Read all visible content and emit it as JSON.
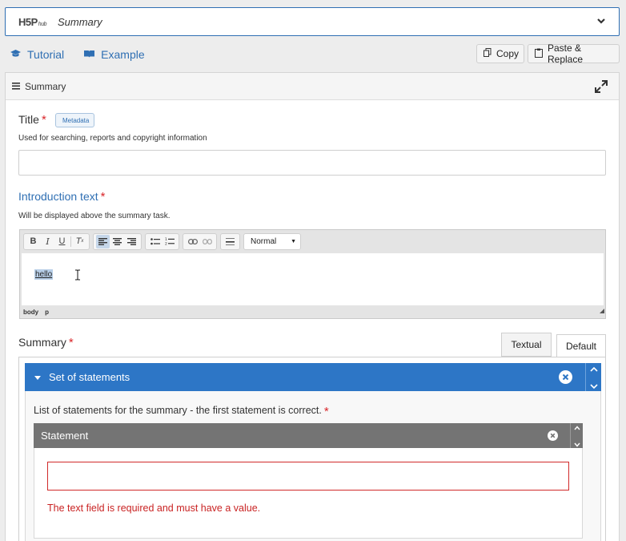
{
  "selector": {
    "logo": "H5P",
    "logo_sub": "hub",
    "title": "Summary"
  },
  "links": {
    "tutorial": "Tutorial",
    "example": "Example"
  },
  "buttons": {
    "copy": "Copy",
    "paste_replace": "Paste & Replace"
  },
  "panel": {
    "title": "Summary",
    "title_field": {
      "label": "Title",
      "required_mark": "*",
      "metadata_label": "Metadata",
      "description": "Used for searching, reports and copyright information",
      "value": ""
    },
    "intro_field": {
      "label": "Introduction text",
      "required_mark": "*",
      "description": "Will be displayed above the summary task.",
      "content": "hello",
      "path": [
        "body",
        "p"
      ],
      "format": "Normal"
    },
    "summary_field": {
      "label": "Summary",
      "required_mark": "*",
      "tabs": [
        "Textual",
        "Default"
      ],
      "active_tab": "Default",
      "group_title": "Set of statements",
      "list_description": "List of statements for the summary - the first statement is correct.",
      "required_mark_list": "*",
      "statement_title": "Statement",
      "statement_value": "",
      "error": "The text field is required and must have a value."
    }
  },
  "colors": {
    "accent": "#2d76c6",
    "error": "#d12a2a",
    "statement_bar": "#747474"
  }
}
